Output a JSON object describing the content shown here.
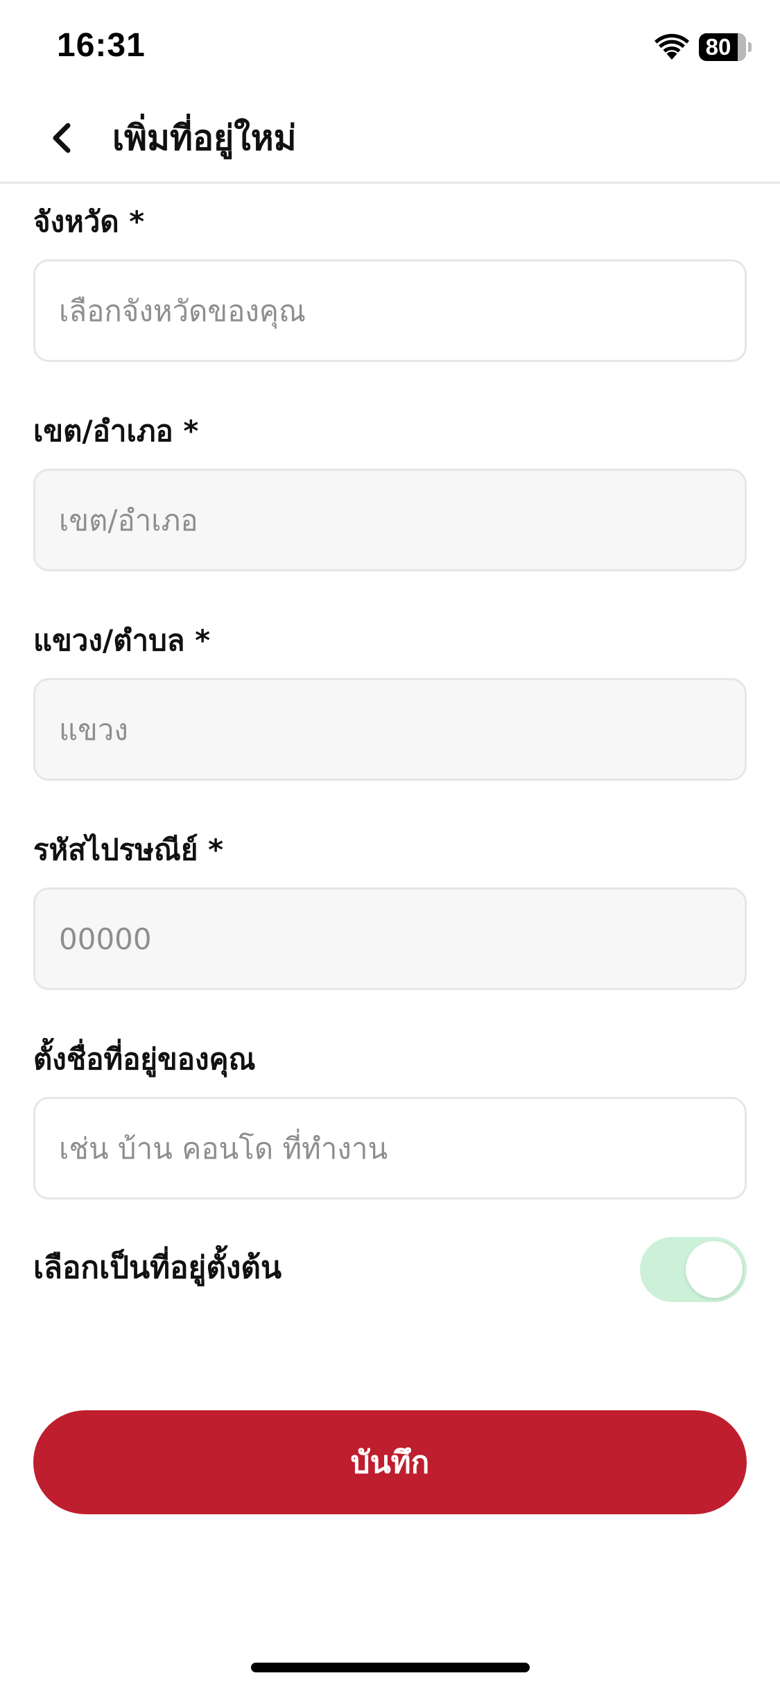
{
  "status_bar": {
    "time": "16:31",
    "battery_level": "80",
    "wifi_icon": "wifi-icon",
    "battery_icon": "battery-icon"
  },
  "nav": {
    "back_icon": "chevron-left-icon",
    "title": "เพิ่มที่อยู่ใหม่"
  },
  "form": {
    "province": {
      "label": "จังหวัด *",
      "placeholder": "เลือกจังหวัดของคุณ",
      "value": ""
    },
    "district": {
      "label": "เขต/อำเภอ *",
      "placeholder": "เขต/อำเภอ",
      "value": ""
    },
    "subdistrict": {
      "label": "แขวง/ตำบล *",
      "placeholder": "แขวง",
      "value": ""
    },
    "postal_code": {
      "label": "รหัสไปรษณีย์ *",
      "placeholder": "00000",
      "value": ""
    },
    "address_name": {
      "label": "ตั้งชื่อที่อยู่ของคุณ",
      "placeholder": "เช่น บ้าน คอนโด ที่ทำงาน",
      "value": ""
    },
    "default_address": {
      "label": "เลือกเป็นที่อยู่ตั้งต้น",
      "enabled": true
    },
    "save_label": "บันทึก"
  },
  "colors": {
    "primary": "#bf1e2e",
    "toggle_track": "#ccf0d8",
    "input_border": "#e6e6e6",
    "input_disabled_bg": "#f7f7f7",
    "placeholder": "#8e8e8e"
  }
}
